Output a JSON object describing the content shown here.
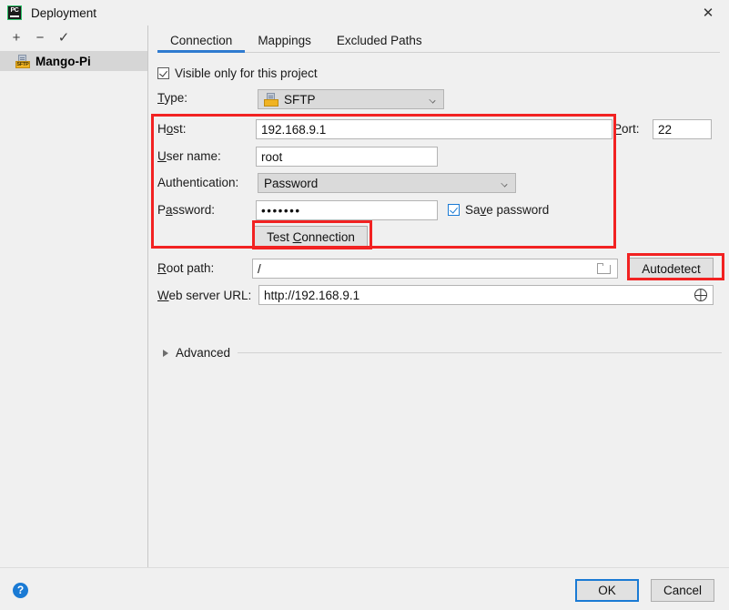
{
  "window": {
    "title": "Deployment",
    "app_icon": "pycharm-icon",
    "close_label": "✕"
  },
  "sidebar": {
    "toolbar": [
      {
        "name": "add-server-button",
        "glyph": "+"
      },
      {
        "name": "remove-server-button",
        "glyph": "−"
      },
      {
        "name": "set-default-button",
        "glyph": "✓"
      }
    ],
    "items": [
      {
        "label": "Mango-Pi",
        "icon": "sftp-icon",
        "icon_text": "SFTP",
        "selected": true
      }
    ]
  },
  "tabs": [
    {
      "label": "Connection",
      "active": true
    },
    {
      "label": "Mappings",
      "active": false
    },
    {
      "label": "Excluded Paths",
      "active": false
    }
  ],
  "form": {
    "visible_only": {
      "label": "Visible only for this project",
      "checked": true
    },
    "type": {
      "label": "Type:",
      "mnemonic": "T",
      "value": "SFTP",
      "icon": "sftp-icon"
    },
    "host": {
      "label": "Host:",
      "mnemonic": "o",
      "value": "192.168.9.1"
    },
    "port": {
      "label": "Port:",
      "mnemonic": "P",
      "value": "22"
    },
    "username": {
      "label": "User name:",
      "mnemonic": "U",
      "value": "root"
    },
    "authentication": {
      "label": "Authentication:",
      "value": "Password"
    },
    "password": {
      "label": "Password:",
      "mnemonic": "a",
      "value": "•••••••"
    },
    "save_password": {
      "label": "Save password",
      "checked": true
    },
    "test_connection": {
      "label": "Test Connection",
      "mnemonic": "C"
    },
    "root_path": {
      "label": "Root path:",
      "mnemonic": "R",
      "value": "/",
      "browse_icon": "folder-icon"
    },
    "autodetect": {
      "label": "Autodetect"
    },
    "web_server_url": {
      "label": "Web server URL:",
      "mnemonic": "W",
      "value": "http://192.168.9.1",
      "open_icon": "globe-icon"
    },
    "advanced": {
      "label": "Advanced",
      "expanded": false
    }
  },
  "footer": {
    "help_label": "?",
    "ok_label": "OK",
    "cancel_label": "Cancel"
  },
  "annotations": {
    "highlight_color": "#f22222",
    "accent_color": "#2f7bd0",
    "boxes": [
      {
        "name": "credentials-highlight"
      },
      {
        "name": "test-connection-highlight"
      },
      {
        "name": "autodetect-highlight"
      }
    ]
  }
}
